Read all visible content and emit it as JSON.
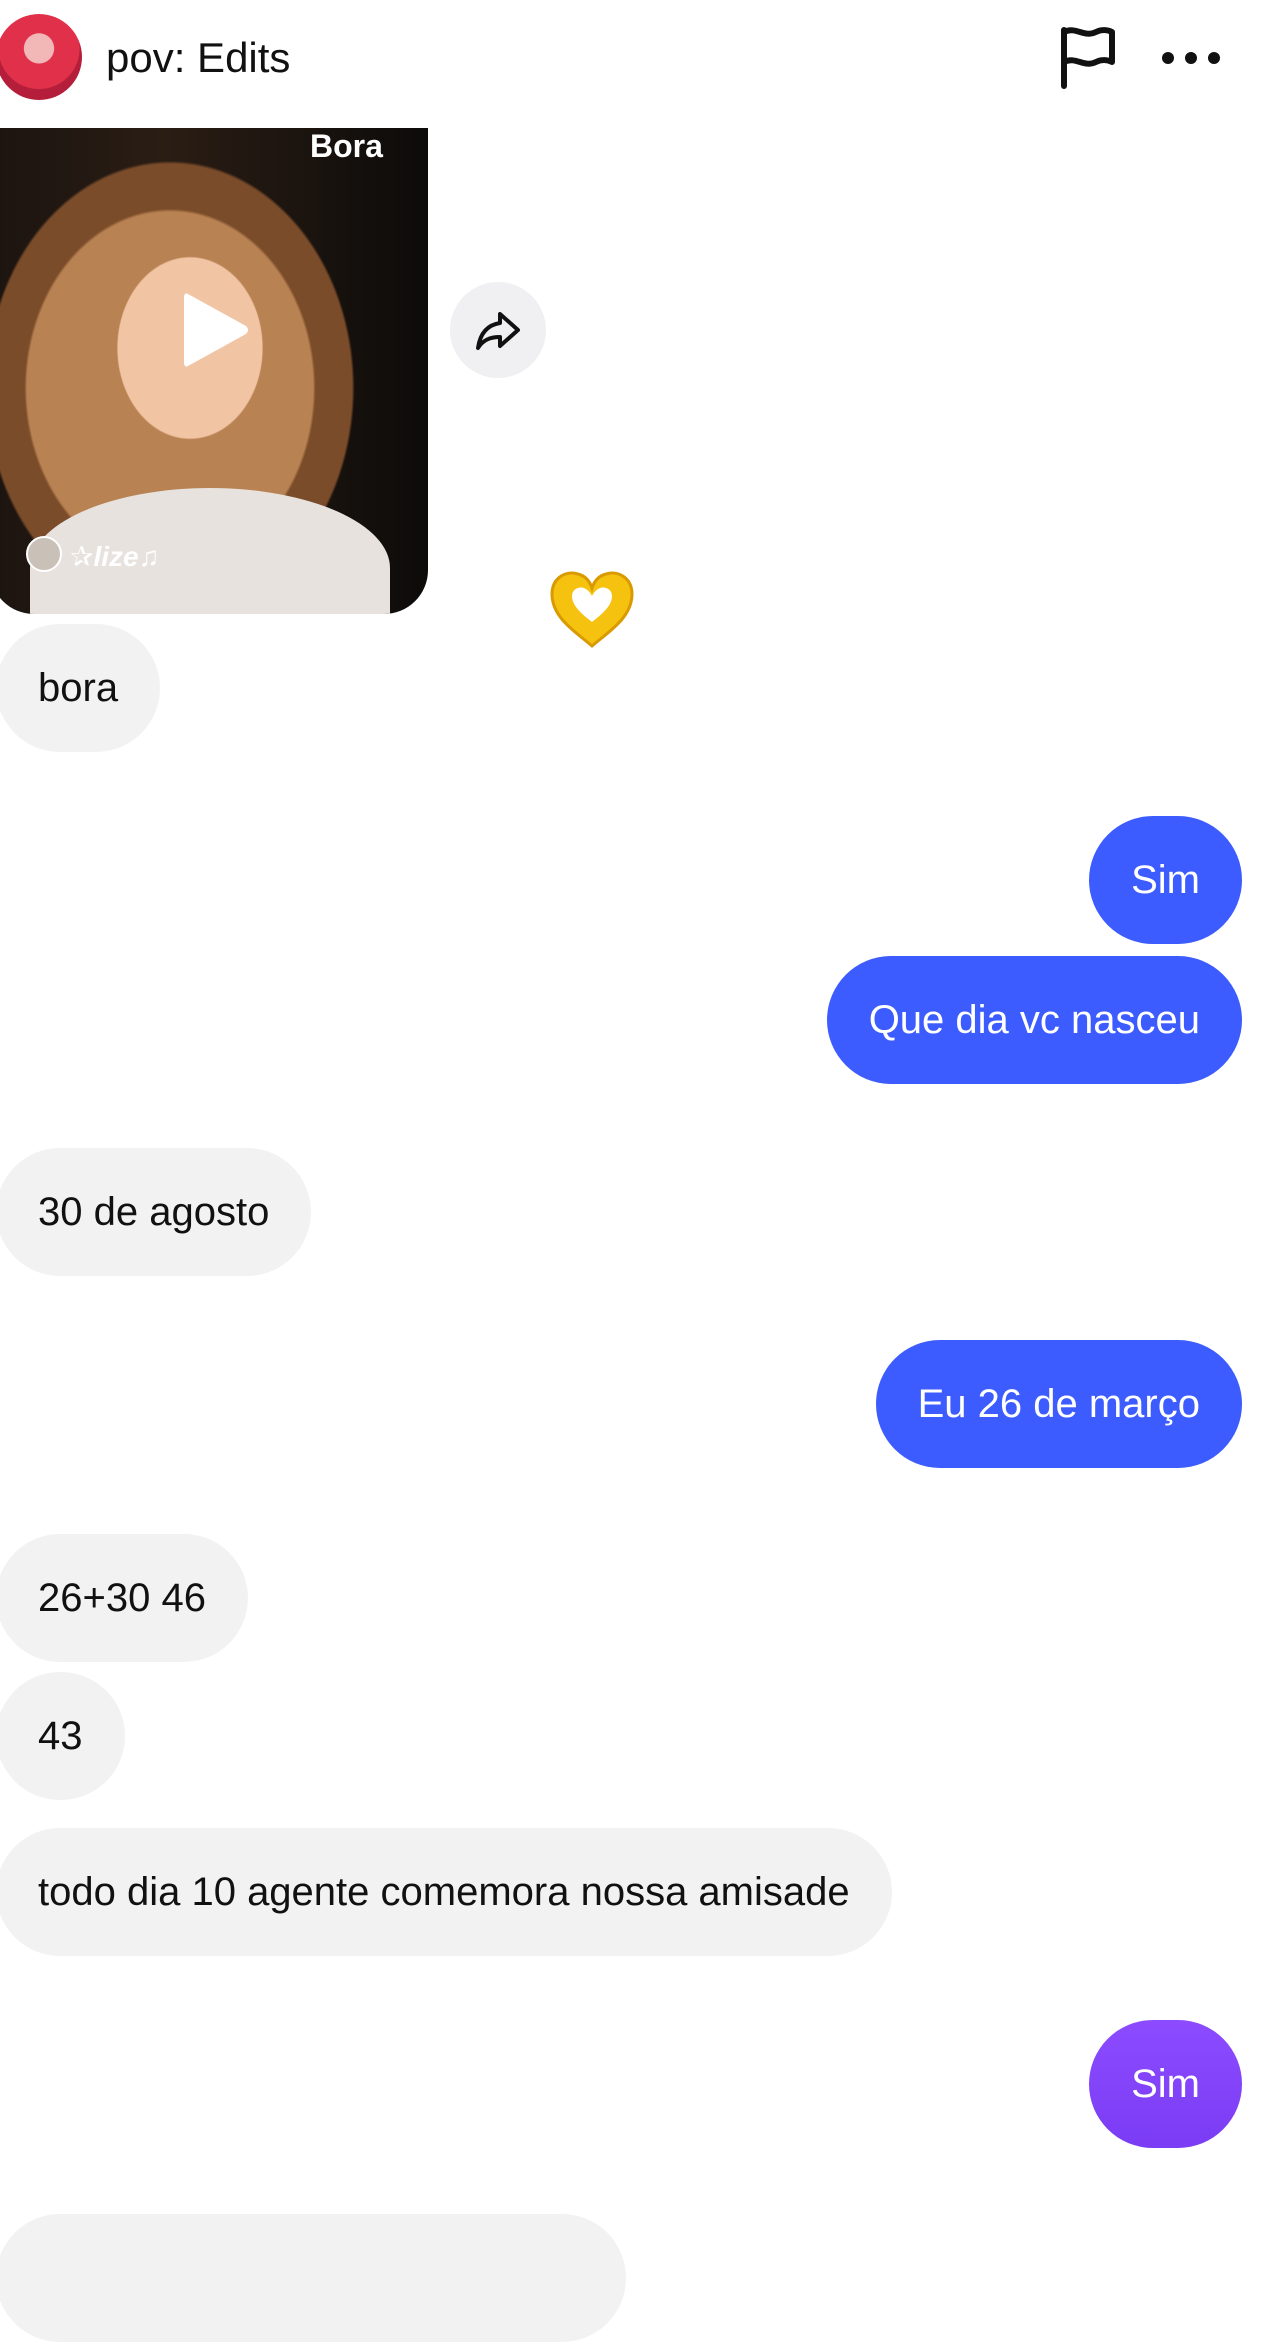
{
  "header": {
    "title": "pov: Edits"
  },
  "video": {
    "caption_top": "Bora",
    "watermark": "✰lize♫"
  },
  "messages": [
    {
      "side": "in",
      "text": "bora"
    },
    {
      "side": "out",
      "text": "Sim"
    },
    {
      "side": "out",
      "text": "Que dia vc nasceu"
    },
    {
      "side": "in",
      "text": "30 de agosto"
    },
    {
      "side": "out",
      "text": "Eu 26 de março"
    },
    {
      "side": "in",
      "text": "26+30 46"
    },
    {
      "side": "in",
      "text": "43"
    },
    {
      "side": "in",
      "text": "todo dia 10 agente comemora nossa amisade"
    },
    {
      "side": "out",
      "text": "Sim"
    }
  ],
  "colors": {
    "outgoing_bubble": "#3d5cff",
    "outgoing_bubble_latest": "#8c4bff",
    "incoming_bubble": "#f2f2f3"
  },
  "icons": {
    "flag": "flag-icon",
    "more": "more-icon",
    "share": "share-icon",
    "play": "play-icon",
    "reaction": "heart-hands-icon"
  }
}
